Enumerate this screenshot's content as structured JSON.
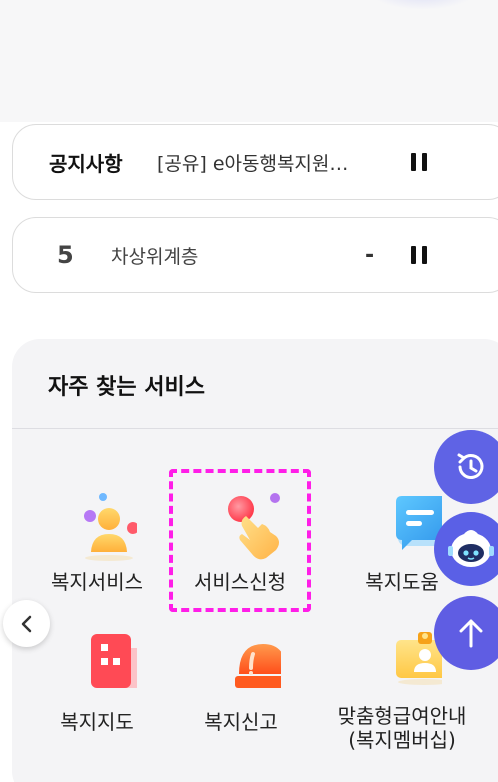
{
  "notice": {
    "title": "공지사항",
    "text": "[공유] e아동행복지원…"
  },
  "ranking": {
    "number": "5",
    "keyword": "차상위계층",
    "change": "-"
  },
  "services": {
    "title": "자주 찾는 서비스",
    "items": [
      {
        "label": "복지서비스",
        "icon": "people-icon"
      },
      {
        "label": "서비스신청",
        "icon": "hand-tap-icon"
      },
      {
        "label": "복지도움",
        "icon": "chat-bubble-icon"
      },
      {
        "label": "복지지도",
        "icon": "map-tiles-icon"
      },
      {
        "label": "복지신고",
        "icon": "siren-icon"
      },
      {
        "label": "맞춤형급여안내",
        "label2": "(복지멤버십)",
        "icon": "id-card-icon"
      }
    ]
  },
  "floating_buttons": [
    {
      "name": "history",
      "icon": "history-icon"
    },
    {
      "name": "chatbot",
      "icon": "chatbot-icon"
    },
    {
      "name": "scroll-top",
      "icon": "arrow-up-icon"
    }
  ],
  "colors": {
    "accent": "#5f63e5",
    "highlight": "#ff1ee8"
  }
}
